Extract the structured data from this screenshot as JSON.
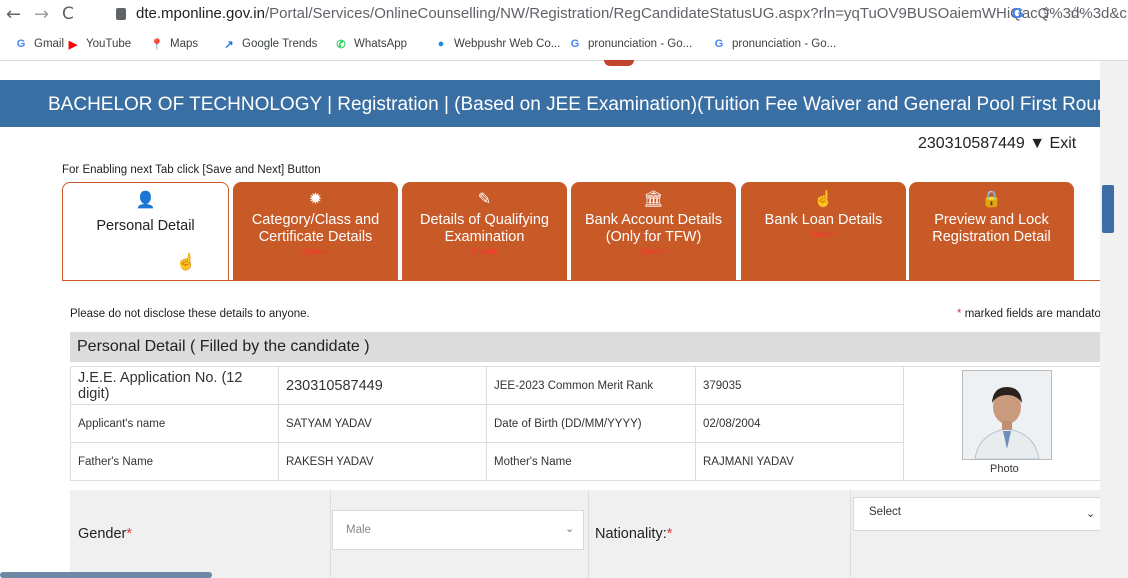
{
  "browser": {
    "url_host": "dte.mponline.gov.in",
    "url_path": "/Portal/Services/OnlineCounselling/NW/Registration/RegCandidateStatusUG.aspx?rln=yqTuOV9BUSOaiemWHiQacQ%3d%3d&c...",
    "back_glyph": "←",
    "forward_glyph": "→",
    "reload_glyph": "C",
    "google_badge": "G",
    "bookmarks": [
      {
        "label": "Gmail",
        "icon": "gmail-icon",
        "glyph": "G",
        "color": "#4285f4"
      },
      {
        "label": "YouTube",
        "icon": "youtube-icon",
        "glyph": "▶",
        "color": "#ff0000"
      },
      {
        "label": "Maps",
        "icon": "maps-icon",
        "glyph": "📍",
        "color": "#34a853"
      },
      {
        "label": "Google Trends",
        "icon": "trends-icon",
        "glyph": "↗",
        "color": "#1a73e8"
      },
      {
        "label": "WhatsApp",
        "icon": "whatsapp-icon",
        "glyph": "✆",
        "color": "#25d366"
      },
      {
        "label": "Webpushr Web Co...",
        "icon": "webpushr-icon",
        "glyph": "●",
        "color": "#1e88e5"
      },
      {
        "label": "pronunciation - Go...",
        "icon": "google-icon",
        "glyph": "G",
        "color": "#4285f4"
      },
      {
        "label": "pronunciation - Go...",
        "icon": "google-icon",
        "glyph": "G",
        "color": "#4285f4"
      }
    ]
  },
  "banner": {
    "title": "BACHELOR OF TECHNOLOGY | Registration | (Based on JEE Examination)(Tuition Fee Waiver and General Pool First Round)"
  },
  "user": {
    "id": "230310587449",
    "menu_glyph": "▼",
    "exit": "Exit"
  },
  "hint": "For Enabling next Tab click [Save and Next] Button",
  "tabs": [
    {
      "label": "Personal Detail",
      "icon": "user-icon",
      "glyph": "👤",
      "status": "",
      "active": true
    },
    {
      "label": "Category/Class and Certificate Details",
      "icon": "certificate-icon",
      "glyph": "✹",
      "status": "Disable",
      "active": false
    },
    {
      "label": "Details of Qualifying Examination",
      "icon": "book-icon",
      "glyph": "✎",
      "status": "Disable",
      "active": false
    },
    {
      "label": "Bank Account Details (Only for TFW)",
      "icon": "bank-icon",
      "glyph": "🏛",
      "status": "Disable",
      "active": false
    },
    {
      "label": "Bank Loan Details",
      "icon": "loan-icon",
      "glyph": "☝",
      "status": "Disable",
      "active": false
    },
    {
      "label": "Preview and Lock Registration Detail",
      "icon": "lock-user-icon",
      "glyph": "🔒",
      "status": "",
      "active": false
    }
  ],
  "notice": "Please do not disclose these details to anyone.",
  "mandatory_note": {
    "star": "*",
    "text": "marked fields are mandato"
  },
  "section": {
    "title": "Personal Detail ( Filled by the candidate )",
    "rows": [
      {
        "label1": "J.E.E. Application No. (12 digit)",
        "value1": "230310587449",
        "label2": "JEE-2023 Common Merit Rank",
        "value2": "379035"
      },
      {
        "label1": "Applicant's name",
        "value1": "SATYAM YADAV",
        "label2": "Date of Birth (DD/MM/YYYY)",
        "value2": "02/08/2004"
      },
      {
        "label1": "Father's Name",
        "value1": "RAKESH YADAV",
        "label2": "Mother's Name",
        "value2": "RAJMANI YADAV"
      }
    ],
    "photo_caption": "Photo"
  },
  "form": {
    "gender_label": "Gender",
    "gender_value": "Male",
    "nationality_label": "Nationality:",
    "nationality_value": "Select",
    "required": "*"
  },
  "colors": {
    "banner": "#3a6fa3",
    "tab": "#c85a28",
    "disable_text": "#ff3333"
  }
}
